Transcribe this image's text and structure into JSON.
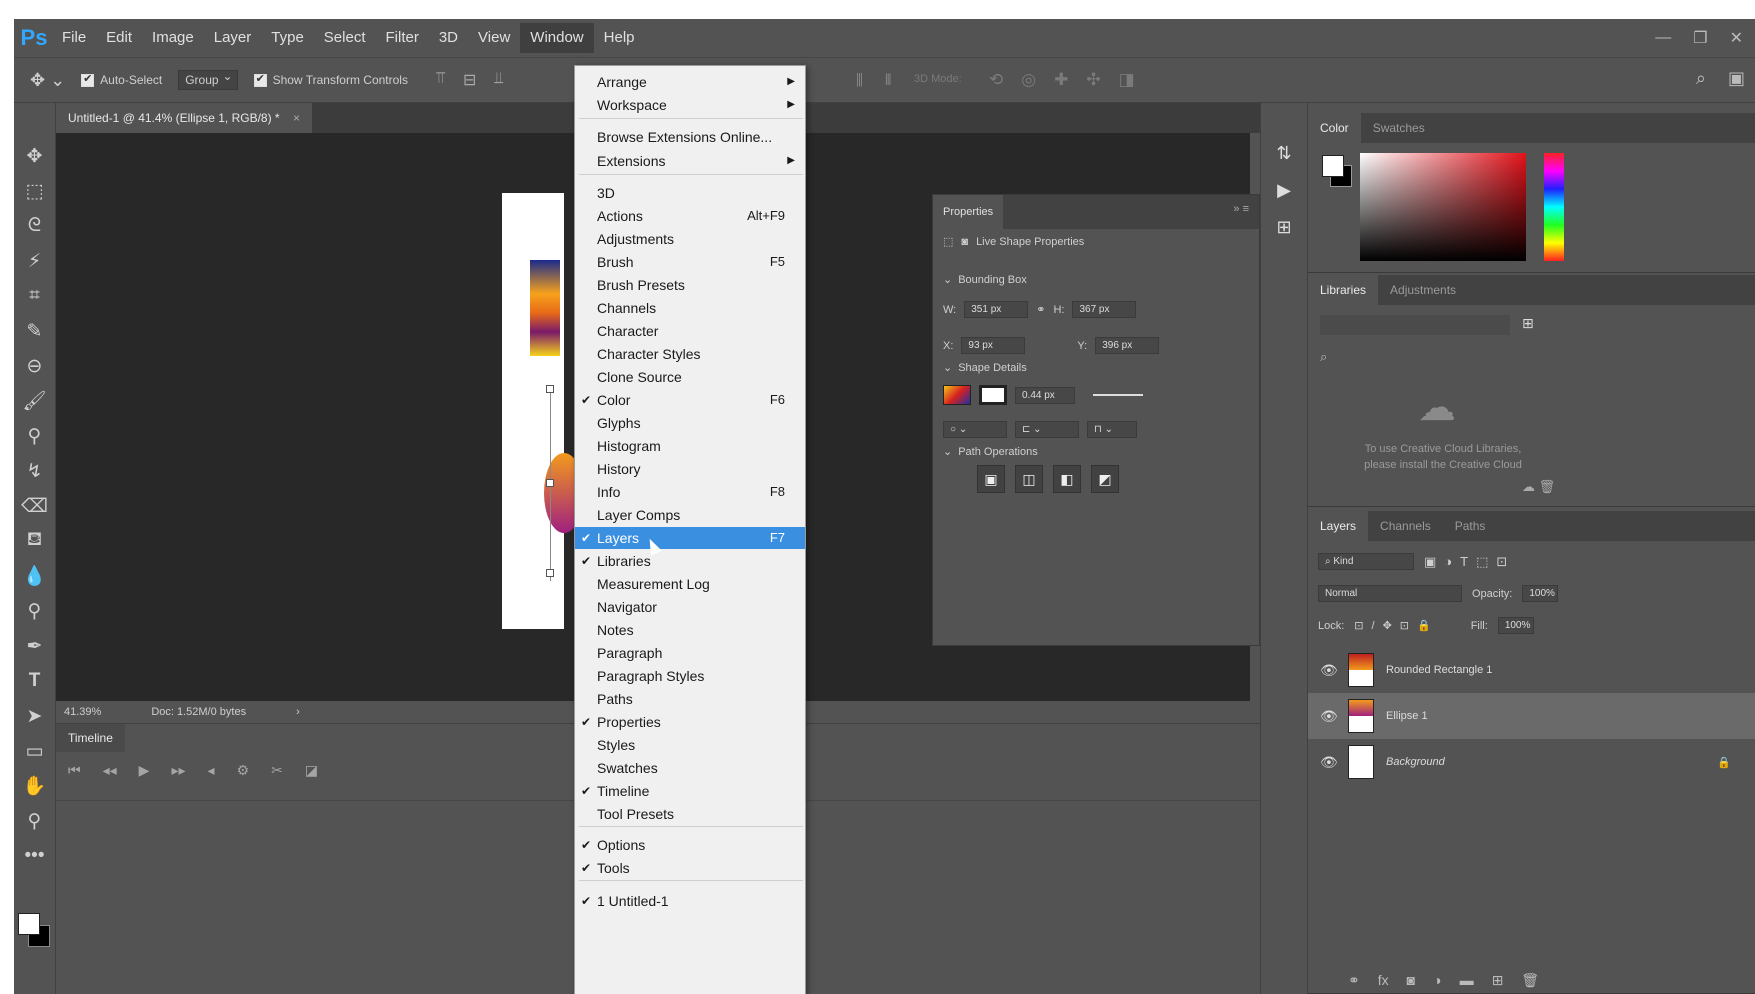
{
  "app": {
    "logo": "Ps"
  },
  "menubar": {
    "items": [
      "File",
      "Edit",
      "Image",
      "Layer",
      "Type",
      "Select",
      "Filter",
      "3D",
      "View",
      "Window",
      "Help"
    ],
    "open_item": "Window"
  },
  "options": {
    "auto_select_label": "Auto-Select",
    "auto_select_value": "Group",
    "show_transform_label": "Show Transform Controls",
    "mode_3d_label": "3D Mode:"
  },
  "document": {
    "tab_title": "Untitled-1 @ 41.4% (Ellipse 1, RGB/8) *",
    "zoom": "41.39%",
    "doc_info": "Doc: 1.52M/0 bytes"
  },
  "timeline": {
    "title": "Timeline"
  },
  "properties": {
    "tab": "Properties",
    "live_shape": "Live Shape Properties",
    "bounding_box": "Bounding Box",
    "w_label": "W:",
    "w_value": "351 px",
    "h_label": "H:",
    "h_value": "367 px",
    "x_label": "X:",
    "x_value": "93 px",
    "y_label": "Y:",
    "y_value": "396 px",
    "shape_details": "Shape Details",
    "stroke_width": "0.44 px",
    "path_operations": "Path Operations"
  },
  "color_panel": {
    "tabs": [
      "Color",
      "Swatches"
    ]
  },
  "libraries_panel": {
    "tabs": [
      "Libraries",
      "Adjustments"
    ],
    "message": "To use Creative Cloud Libraries, please install the Creative Cloud"
  },
  "layers_panel": {
    "tabs": [
      "Layers",
      "Channels",
      "Paths"
    ],
    "kind_label": "Kind",
    "blend_mode": "Normal",
    "opacity_label": "Opacity:",
    "opacity_value": "100%",
    "lock_label": "Lock:",
    "fill_label": "Fill:",
    "fill_value": "100%",
    "layers": [
      {
        "name": "Rounded Rectangle 1",
        "selected": false
      },
      {
        "name": "Ellipse 1",
        "selected": true
      },
      {
        "name": "Background",
        "selected": false
      }
    ]
  },
  "window_menu": {
    "items": [
      {
        "label": "Arrange",
        "submenu": true
      },
      {
        "label": "Workspace",
        "submenu": true
      },
      {
        "label": "Browse Extensions Online..."
      },
      {
        "label": "Extensions",
        "submenu": true
      },
      {
        "label": "3D"
      },
      {
        "label": "Actions",
        "shortcut": "Alt+F9"
      },
      {
        "label": "Adjustments"
      },
      {
        "label": "Brush",
        "shortcut": "F5"
      },
      {
        "label": "Brush Presets"
      },
      {
        "label": "Channels"
      },
      {
        "label": "Character"
      },
      {
        "label": "Character Styles"
      },
      {
        "label": "Clone Source"
      },
      {
        "label": "Color",
        "shortcut": "F6",
        "checked": true
      },
      {
        "label": "Glyphs"
      },
      {
        "label": "Histogram"
      },
      {
        "label": "History"
      },
      {
        "label": "Info",
        "shortcut": "F8"
      },
      {
        "label": "Layer Comps"
      },
      {
        "label": "Layers",
        "shortcut": "F7",
        "checked": true,
        "highlighted": true
      },
      {
        "label": "Libraries",
        "checked": true
      },
      {
        "label": "Measurement Log"
      },
      {
        "label": "Navigator"
      },
      {
        "label": "Notes"
      },
      {
        "label": "Paragraph"
      },
      {
        "label": "Paragraph Styles"
      },
      {
        "label": "Paths"
      },
      {
        "label": "Properties",
        "checked": true
      },
      {
        "label": "Styles"
      },
      {
        "label": "Swatches"
      },
      {
        "label": "Timeline",
        "checked": true
      },
      {
        "label": "Tool Presets"
      },
      {
        "label": "Options",
        "checked": true
      },
      {
        "label": "Tools",
        "checked": true
      },
      {
        "label": "1 Untitled-1",
        "checked": true
      }
    ]
  },
  "colors": {
    "menu_highlight": "#3a8fe0",
    "ps_blue": "#31a8ff",
    "ui_gray": "#535353"
  }
}
